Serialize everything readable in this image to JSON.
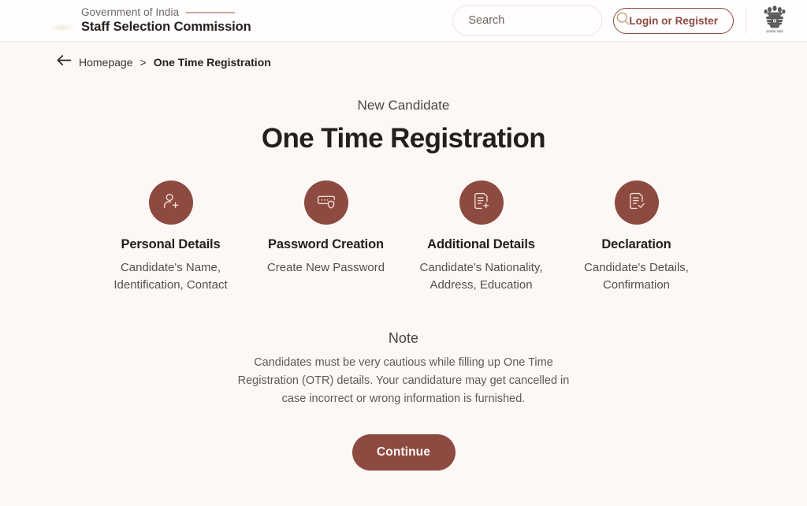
{
  "header": {
    "gov_line": "Government of India",
    "org_name": "Staff Selection Commission",
    "emblem_icon": "india-national-emblem",
    "emblem_caption": "सत्यमेव जयते",
    "search": {
      "value": "",
      "placeholder": "Search",
      "icon": "search-icon"
    },
    "login_label": "Login or Register"
  },
  "breadcrumb": {
    "back_icon": "arrow-left-icon",
    "home_label": "Homepage",
    "separator": ">",
    "current_label": "One Time Registration"
  },
  "main": {
    "eyebrow": "New Candidate",
    "title": "One Time Registration"
  },
  "steps": [
    {
      "icon": "user-add-icon",
      "title": "Personal Details",
      "description": "Candidate's Name, Identification, Contact"
    },
    {
      "icon": "password-shield-icon",
      "title": "Password Creation",
      "description": "Create New Password"
    },
    {
      "icon": "document-add-icon",
      "title": "Additional Details",
      "description": "Candidate's Nationality, Address, Education"
    },
    {
      "icon": "document-check-icon",
      "title": "Declaration",
      "description": "Candidate's Details, Confirmation"
    }
  ],
  "note": {
    "title": "Note",
    "body": "Candidates must be very cautious while filling up One Time Registration (OTR) details. Your candidature may get cancelled in case incorrect or wrong information is furnished."
  },
  "cta": {
    "continue_label": "Continue"
  },
  "colors": {
    "brand_maroon": "#8d4a40",
    "page_background": "#fdf8f6",
    "header_background": "#fffdfd",
    "search_icon": "#b99a70",
    "brand_rule": "#c9a79a"
  }
}
